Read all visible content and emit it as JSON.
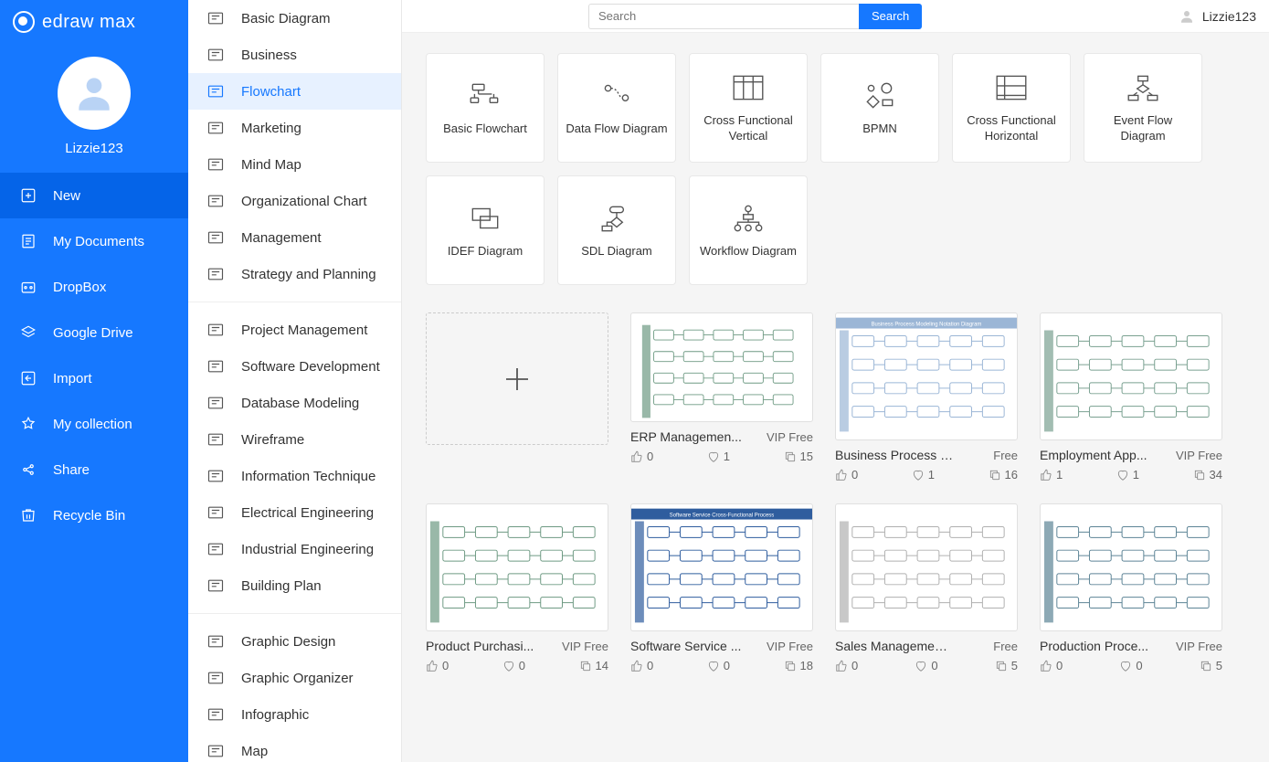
{
  "app": {
    "name": "edraw max"
  },
  "search": {
    "placeholder": "Search",
    "button": "Search"
  },
  "user": {
    "name": "Lizzie123"
  },
  "sidebar": {
    "username": "Lizzie123",
    "items": [
      {
        "label": "New",
        "active": true
      },
      {
        "label": "My Documents"
      },
      {
        "label": "DropBox"
      },
      {
        "label": "Google Drive"
      },
      {
        "label": "Import"
      },
      {
        "label": "My collection"
      },
      {
        "label": "Share"
      },
      {
        "label": "Recycle Bin"
      }
    ]
  },
  "categories": {
    "group1": [
      "Basic Diagram",
      "Business",
      "Flowchart",
      "Marketing",
      "Mind Map",
      "Organizational Chart",
      "Management",
      "Strategy and Planning"
    ],
    "selected": "Flowchart",
    "group2": [
      "Project Management",
      "Software Development",
      "Database Modeling",
      "Wireframe",
      "Information Technique",
      "Electrical Engineering",
      "Industrial Engineering",
      "Building Plan"
    ],
    "group3": [
      "Graphic Design",
      "Graphic Organizer",
      "Infographic",
      "Map"
    ]
  },
  "types": [
    "Basic Flowchart",
    "Data Flow Diagram",
    "Cross Functional Vertical",
    "BPMN",
    "Cross Functional Horizontal",
    "Event Flow Diagram",
    "IDEF Diagram",
    "SDL Diagram",
    "Workflow Diagram"
  ],
  "templates": [
    {
      "title": "ERP Managemen...",
      "price": "VIP Free",
      "likes": "0",
      "loves": "1",
      "copies": "15",
      "th": 120,
      "hue": "#6e9a83"
    },
    {
      "title": "Business Process Mo...",
      "price": "Free",
      "likes": "0",
      "loves": "1",
      "copies": "16",
      "th": 140,
      "hue": "#9bb6d6",
      "caption": "Business Process Modeling Notation Diagram"
    },
    {
      "title": "Employment App...",
      "price": "VIP Free",
      "likes": "1",
      "loves": "1",
      "copies": "34",
      "th": 140,
      "hue": "#7aa191"
    },
    {
      "title": "Product Purchasi...",
      "price": "VIP Free",
      "likes": "0",
      "loves": "0",
      "copies": "14",
      "th": 140,
      "hue": "#6e9a83"
    },
    {
      "title": "Software Service ...",
      "price": "VIP Free",
      "likes": "0",
      "loves": "0",
      "copies": "18",
      "th": 140,
      "hue": "#2f5d9e",
      "caption": "Software Service Cross-Functional Process"
    },
    {
      "title": "Sales Management C...",
      "price": "Free",
      "likes": "0",
      "loves": "0",
      "copies": "5",
      "th": 140,
      "hue": "#b0b0b0"
    },
    {
      "title": "Production Proce...",
      "price": "VIP Free",
      "likes": "0",
      "loves": "0",
      "copies": "5",
      "th": 140,
      "hue": "#5d8496"
    }
  ]
}
